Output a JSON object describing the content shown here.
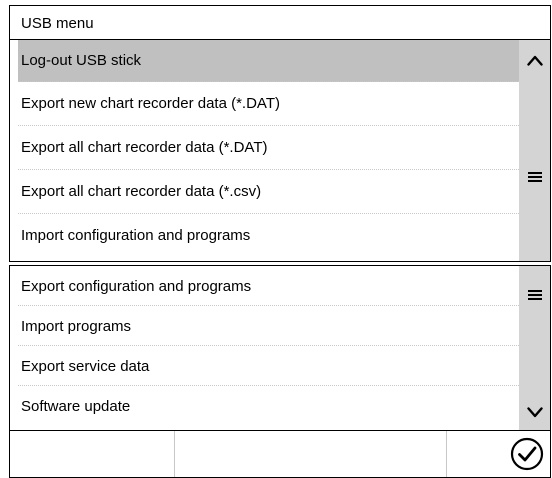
{
  "window": {
    "title": "USB menu"
  },
  "menu": {
    "upper_items": [
      {
        "label": "Log-out USB stick",
        "selected": true
      },
      {
        "label": "Export new chart recorder data (*.DAT)",
        "selected": false
      },
      {
        "label": "Export all chart recorder data (*.DAT)",
        "selected": false
      },
      {
        "label": "Export all chart recorder data (*.csv)",
        "selected": false
      },
      {
        "label": "Import configuration and programs",
        "selected": false
      }
    ],
    "lower_items": [
      {
        "label": "Export configuration and programs",
        "selected": false
      },
      {
        "label": "Import programs",
        "selected": false
      },
      {
        "label": "Export service data",
        "selected": false
      },
      {
        "label": "Software update",
        "selected": false
      }
    ]
  },
  "scrollbar": {
    "up_icon": "chevron-up-icon",
    "thumb_icon": "menu-lines-icon",
    "down_icon": "chevron-down-icon"
  },
  "footer": {
    "confirm_icon": "check-circle-icon"
  },
  "colors": {
    "selected_row": "#c0c0c0",
    "scrollbar_track": "#d4d4d4",
    "border": "#000000"
  }
}
